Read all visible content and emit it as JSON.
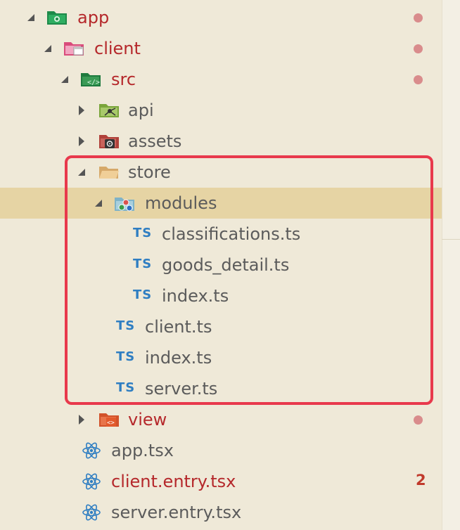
{
  "tree": {
    "app": {
      "label": "app",
      "status_dot_color": "#d98c8c"
    },
    "client": {
      "label": "client"
    },
    "src": {
      "label": "src"
    },
    "api": {
      "label": "api"
    },
    "assets": {
      "label": "assets"
    },
    "store": {
      "label": "store"
    },
    "modules": {
      "label": "modules"
    },
    "classifications": {
      "label": "classifications.ts",
      "icon_text": "TS"
    },
    "goods_detail": {
      "label": "goods_detail.ts",
      "icon_text": "TS"
    },
    "modules_index": {
      "label": "index.ts",
      "icon_text": "TS"
    },
    "store_client": {
      "label": "client.ts",
      "icon_text": "TS"
    },
    "store_index": {
      "label": "index.ts",
      "icon_text": "TS"
    },
    "store_server": {
      "label": "server.ts",
      "icon_text": "TS"
    },
    "view": {
      "label": "view"
    },
    "app_tsx": {
      "label": "app.tsx"
    },
    "client_entry": {
      "label": "client.entry.tsx",
      "badge": "2"
    },
    "server_entry": {
      "label": "server.entry.tsx"
    }
  },
  "colors": {
    "background": "#efe9d8",
    "selection": "#e6d4a4",
    "modified_text": "#b5282b",
    "ts_blue": "#2f7ec2",
    "highlight_border": "#e8394c",
    "react_blue": "#2f7ec2"
  },
  "icons": {
    "app": "green-app-folder-icon",
    "client": "pink-client-folder-icon",
    "src": "green-src-folder-icon",
    "api": "api-folder-icon",
    "assets": "assets-folder-icon",
    "store": "folder-open-icon",
    "modules": "modules-folder-icon",
    "ts": "typescript-icon",
    "view": "html-view-folder-icon",
    "react": "react-icon"
  }
}
